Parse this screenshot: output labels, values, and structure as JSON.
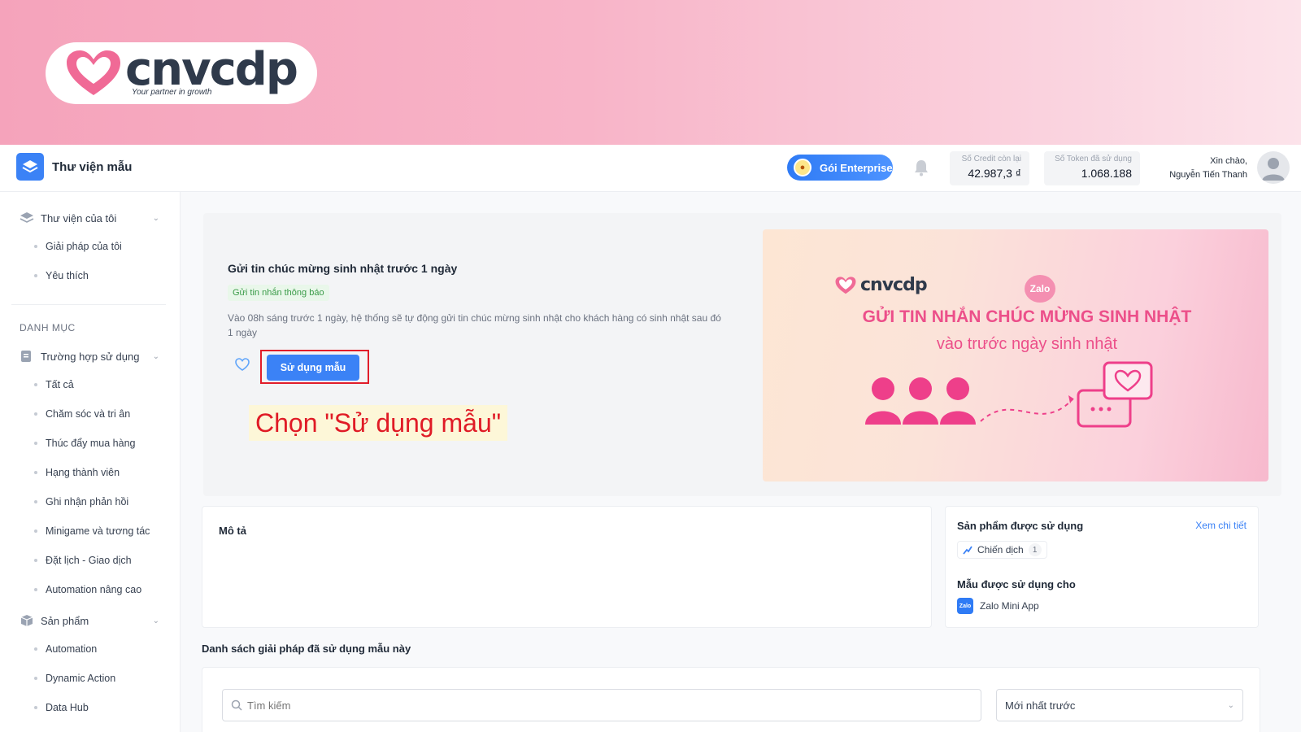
{
  "brand": {
    "name": "cnvcdp",
    "tagline": "Your partner in growth"
  },
  "header": {
    "title": "Thư viện mẫu",
    "plan_label": "Gói Enterprise",
    "credit": {
      "label": "Số Credit còn lại",
      "value": "42.987,3 ₫"
    },
    "token": {
      "label": "Số Token đã sử dụng",
      "value": "1.068.188"
    },
    "greeting": "Xin chào,",
    "user_name": "Nguyễn Tiến Thanh"
  },
  "sidebar": {
    "my_library": "Thư viện của tôi",
    "my_library_items": [
      "Giải pháp của tôi",
      "Yêu thích"
    ],
    "category_heading": "DANH MỤC",
    "use_cases": "Trường hợp sử dụng",
    "use_case_items": [
      "Tất cả",
      "Chăm sóc và tri ân",
      "Thúc đẩy mua hàng",
      "Hạng thành viên",
      "Ghi nhận phản hồi",
      "Minigame và tương tác",
      "Đặt lịch - Giao dịch",
      "Automation nâng cao"
    ],
    "products": "Sản phẩm",
    "product_items": [
      "Automation",
      "Dynamic Action",
      "Data Hub"
    ]
  },
  "template": {
    "title": "Gửi tin chúc mừng sinh nhật trước 1 ngày",
    "tag": "Gửi tin nhắn thông báo",
    "description": "Vào 08h sáng trước 1 ngày, hệ thống sẽ tự động gửi tin chúc mừng sinh nhật cho khách hàng có sinh nhật sau đó 1 ngày",
    "use_button": "Sử dụng mẫu",
    "callout": "Chọn \"Sử dụng mẫu\""
  },
  "promo": {
    "logo": "cnvcdp",
    "zalo": "Zalo",
    "headline": "GỬI TIN NHẮN CHÚC MỪNG SINH NHẬT",
    "subline": "vào trước ngày sinh nhật"
  },
  "description_card": {
    "label": "Mô tả"
  },
  "products_card": {
    "title": "Sản phẩm được sử dụng",
    "view_detail": "Xem chi tiết",
    "chip_label": "Chiến dịch",
    "chip_count": "1",
    "used_for_title": "Mẫu được sử dụng cho",
    "app_badge": "Zalo",
    "app_name": "Zalo Mini App"
  },
  "solutions_list": {
    "title": "Danh sách giải pháp đã sử dụng mẫu này",
    "search_placeholder": "Tìm kiếm",
    "sort_value": "Mới nhất trước"
  },
  "colors": {
    "primary": "#3b82f6",
    "accent_pink": "#ec4f8a",
    "highlight_red": "#e11d2a"
  }
}
